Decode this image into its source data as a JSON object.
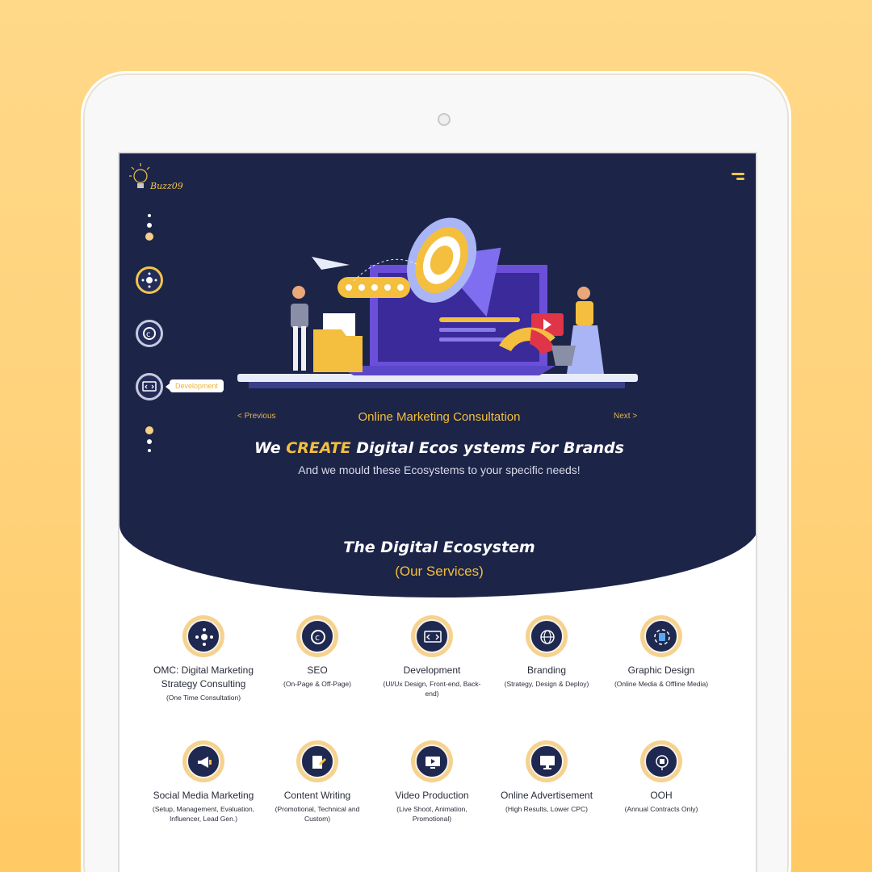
{
  "brand": {
    "logo_text": "Buzz09"
  },
  "sidebar": {
    "tooltip": "Development"
  },
  "hero": {
    "prev_label": "< Previous",
    "next_label": "Next >",
    "slide_title": "Online Marketing Consultation",
    "headline_pre": "We ",
    "headline_highlight": "CREATE",
    "headline_post": " Digital Ecos ystems For Brands",
    "subline": "And we mould these Ecosystems to your specific  needs!"
  },
  "section": {
    "title": "The Digital Ecosystem",
    "subtitle": "(Our Services)"
  },
  "services": [
    {
      "name": "OMC: Digital Marketing Strategy Consulting",
      "desc": "(One Time Consultation)",
      "icon": "network-icon"
    },
    {
      "name": "SEO",
      "desc": "(On-Page & Off-Page)",
      "icon": "seo-icon"
    },
    {
      "name": "Development",
      "desc": "(UI/Ux Design, Front-end, Back-end)",
      "icon": "code-icon"
    },
    {
      "name": "Branding",
      "desc": "(Strategy, Design & Deploy)",
      "icon": "globe-icon"
    },
    {
      "name": "Graphic Design",
      "desc": "(Online Media & Offline Media)",
      "icon": "design-icon"
    },
    {
      "name": "Social Media Marketing",
      "desc": "(Setup, Management, Evaluation, Influencer, Lead Gen.)",
      "icon": "megaphone-icon"
    },
    {
      "name": "Content Writing",
      "desc": "(Promotional, Technical and Custom)",
      "icon": "pen-icon"
    },
    {
      "name": "Video Production",
      "desc": "(Live Shoot, Animation, Promotional)",
      "icon": "video-icon"
    },
    {
      "name": "Online Advertisement",
      "desc": "(High Results, Lower CPC)",
      "icon": "monitor-icon"
    },
    {
      "name": "OOH",
      "desc": "(Annual Contracts Only)",
      "icon": "billboard-icon"
    }
  ],
  "colors": {
    "navy": "#1c2448",
    "gold": "#f4bf3e",
    "page_bg": "#ffd27a"
  }
}
